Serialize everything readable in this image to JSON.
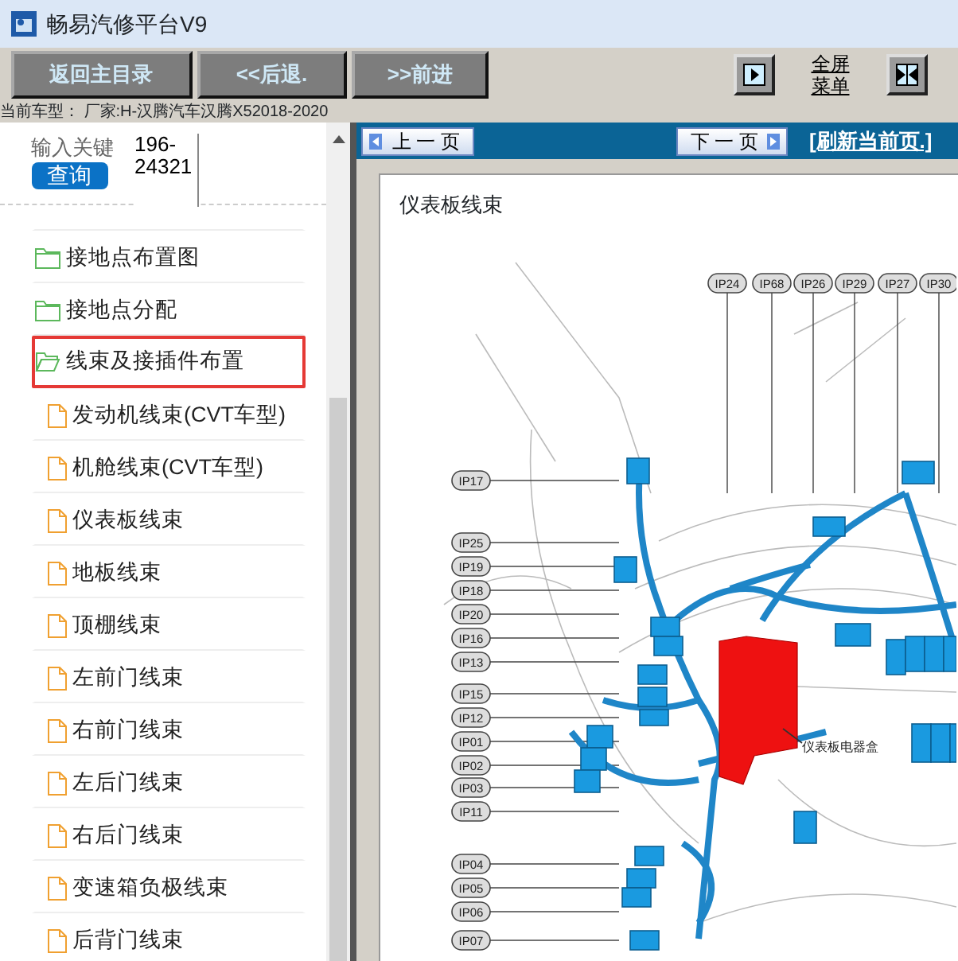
{
  "window": {
    "title": "畅易汽修平台V9"
  },
  "toolbar": {
    "buttons": [
      "返回主目录",
      "<<后退.",
      ">>前进"
    ],
    "fullscreen_menu": [
      "全屏",
      "菜单"
    ]
  },
  "car_info": "当前车型： 厂家:H-汉腾汽车汉腾X52018-2020",
  "search": {
    "label": "输入关键",
    "button": "查询",
    "value": "196-24321"
  },
  "tree": {
    "items": [
      {
        "label": "接地点布置图",
        "kind": "folder",
        "expanded": false,
        "selected": false
      },
      {
        "label": "接地点分配",
        "kind": "folder",
        "expanded": false,
        "selected": false
      },
      {
        "label": "线束及接插件布置",
        "kind": "folder",
        "expanded": true,
        "selected": true,
        "children": [
          {
            "label": "发动机线束(CVT车型)",
            "kind": "file",
            "selected": false
          },
          {
            "label": "机舱线束(CVT车型)",
            "kind": "file",
            "selected": false
          },
          {
            "label": "仪表板线束",
            "kind": "file",
            "selected": false
          },
          {
            "label": "地板线束",
            "kind": "file",
            "selected": false
          },
          {
            "label": "顶棚线束",
            "kind": "file",
            "selected": false
          },
          {
            "label": "左前门线束",
            "kind": "file",
            "selected": false
          },
          {
            "label": "右前门线束",
            "kind": "file",
            "selected": false
          },
          {
            "label": "左后门线束",
            "kind": "file",
            "selected": false
          },
          {
            "label": "右后门线束",
            "kind": "file",
            "selected": false
          },
          {
            "label": "变速箱负极线束",
            "kind": "file",
            "selected": false
          },
          {
            "label": "后背门线束",
            "kind": "file",
            "selected": false
          }
        ]
      }
    ]
  },
  "viewer": {
    "prev": "上 一 页",
    "next": "下 一 页",
    "refresh": "[刷新当前页.]",
    "page_title": "仪表板线束",
    "diagram": {
      "top_labels": [
        "IP24",
        "IP68",
        "IP26",
        "IP29",
        "IP27",
        "IP30"
      ],
      "left_labels": [
        "IP17",
        "IP25",
        "IP19",
        "IP18",
        "IP20",
        "IP16",
        "IP13",
        "IP15",
        "IP12",
        "IP01",
        "IP02",
        "IP03",
        "IP11",
        "IP04",
        "IP05",
        "IP06",
        "IP07"
      ],
      "callout": "仪表板电器盒"
    }
  }
}
